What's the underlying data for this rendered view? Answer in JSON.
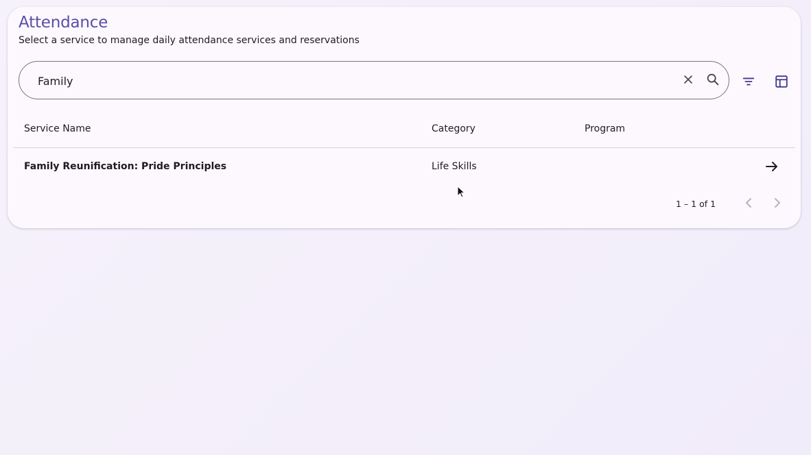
{
  "header": {
    "title": "Attendance",
    "subtitle": "Select a service to manage daily attendance services and reservations"
  },
  "search": {
    "value": "Family",
    "clear_icon": "close-icon",
    "search_icon": "search-icon"
  },
  "toolbar": {
    "filter_icon": "filter-icon",
    "columns_icon": "table-columns-icon"
  },
  "table": {
    "columns": [
      "Service Name",
      "Category",
      "Program"
    ],
    "rows": [
      {
        "service_name": "Family Reunification: Pride Principles",
        "category": "Life Skills",
        "program": ""
      }
    ]
  },
  "pagination": {
    "range_label": "1 – 1 of 1"
  },
  "colors": {
    "accent": "#5a4fa6",
    "card_bg": "#fcf8fd",
    "page_bg": "#f3eefb",
    "border": "#79747e"
  }
}
